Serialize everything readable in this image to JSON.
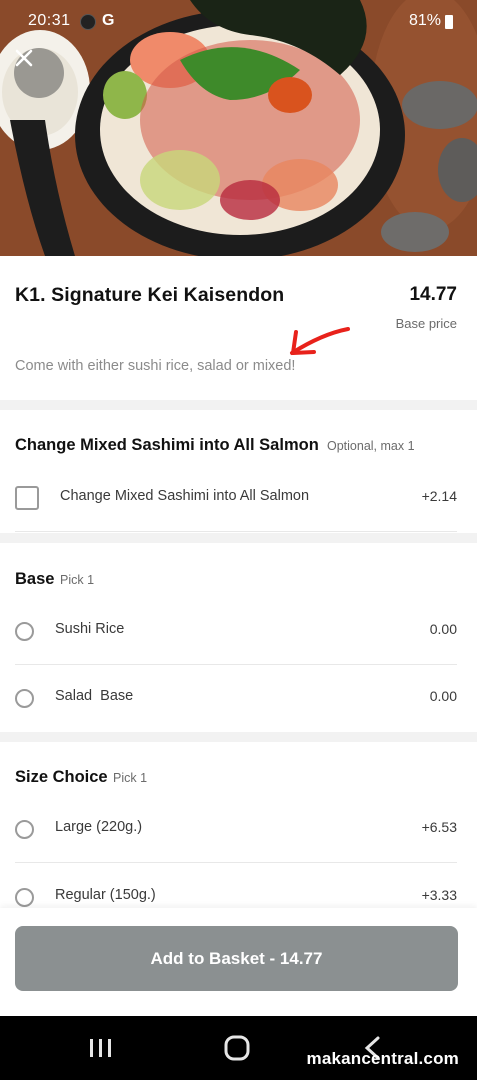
{
  "status_bar": {
    "time": "20:31",
    "carrier_glyph": "G",
    "battery": "81%"
  },
  "item": {
    "title": "K1. Signature Kei Kaisendon",
    "price": "14.77",
    "price_caption": "Base price",
    "description": "Come with either sushi rice, salad or mixed!"
  },
  "groups": [
    {
      "title": "Change Mixed Sashimi into All Salmon",
      "hint": "Optional, max 1",
      "options": [
        {
          "label": "Change Mixed Sashimi into All Salmon",
          "price": "+2.14",
          "control": "checkbox"
        }
      ]
    },
    {
      "title": "Base",
      "hint": "Pick 1",
      "options": [
        {
          "label": "Sushi Rice",
          "price": "0.00",
          "control": "radio"
        },
        {
          "label": "Salad  Base",
          "price": "0.00",
          "control": "radio"
        }
      ]
    },
    {
      "title": "Size Choice",
      "hint": "Pick 1",
      "options": [
        {
          "label": "Large (220g.)",
          "price": "+6.53",
          "control": "radio"
        },
        {
          "label": "Regular (150g.)",
          "price": "+3.33",
          "control": "radio"
        }
      ]
    }
  ],
  "cta": {
    "label": "Add to Basket - 14.77"
  },
  "watermark": "makancentral.com",
  "icons": {
    "close": "close-icon",
    "annotation_arrow": "arrow-icon",
    "recents": "recents-icon",
    "home": "home-icon",
    "back": "back-icon"
  },
  "colors": {
    "cta_background": "#8b9091",
    "arrow": "#e8221b",
    "section_gap": "#f2f2f2"
  }
}
